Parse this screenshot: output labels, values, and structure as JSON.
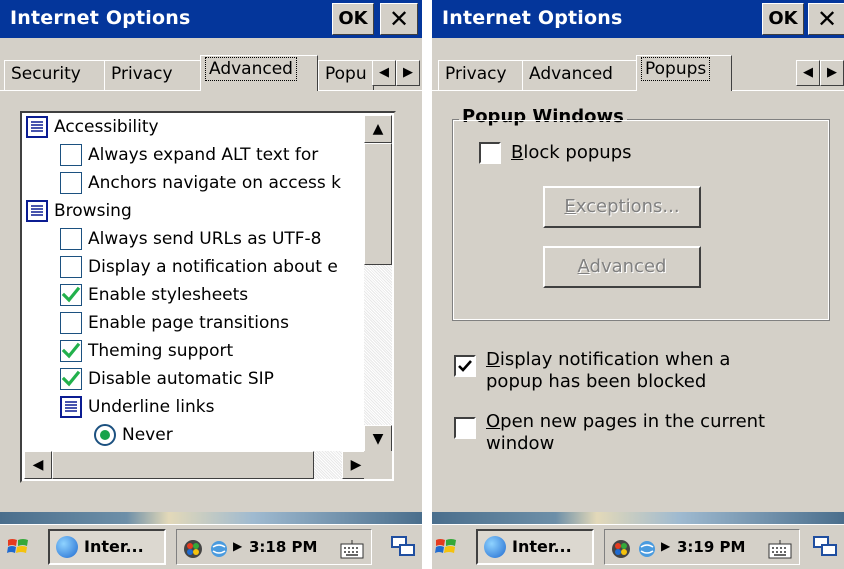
{
  "left": {
    "window": {
      "title": "Internet Options",
      "ok_label": "OK",
      "close_label": "✕"
    },
    "tabs": [
      "Security",
      "Privacy",
      "Advanced",
      "Popu"
    ],
    "active_tab": "Advanced",
    "tree": [
      {
        "kind": "category",
        "label": "Accessibility"
      },
      {
        "kind": "checkbox",
        "label": "Always expand ALT text for",
        "checked": false
      },
      {
        "kind": "checkbox",
        "label": "Anchors navigate on access k",
        "checked": false
      },
      {
        "kind": "category",
        "label": "Browsing"
      },
      {
        "kind": "checkbox",
        "label": "Always send URLs as UTF-8",
        "checked": false
      },
      {
        "kind": "checkbox",
        "label": "Display a notification about e",
        "checked": false
      },
      {
        "kind": "checkbox",
        "label": "Enable stylesheets",
        "checked": true
      },
      {
        "kind": "checkbox",
        "label": "Enable page transitions",
        "checked": false
      },
      {
        "kind": "checkbox",
        "label": "Theming support",
        "checked": true
      },
      {
        "kind": "checkbox",
        "label": "Disable automatic SIP",
        "checked": true
      },
      {
        "kind": "category",
        "label": "Underline links"
      },
      {
        "kind": "radio",
        "label": "Never",
        "selected": true
      }
    ],
    "taskbar": {
      "task_label": "Inter...",
      "clock": "3:18 PM"
    }
  },
  "right": {
    "window": {
      "title": "Internet Options",
      "ok_label": "OK",
      "close_label": "✕"
    },
    "tabs": [
      "Privacy",
      "Advanced",
      "Popups"
    ],
    "active_tab": "Popups",
    "group": {
      "title": "Popup Windows",
      "block_popups": {
        "label_mnemonic": "B",
        "label_rest": "lock popups",
        "checked": false
      },
      "exceptions_button": {
        "mnemonic": "E",
        "rest": "xceptions..."
      },
      "advanced_button": {
        "before": "",
        "mnemonic": "A",
        "rest": "dvanced"
      }
    },
    "options": [
      {
        "mnemonic": "D",
        "line1_rest": "isplay notification when a",
        "line2": "popup has been blocked",
        "checked": true
      },
      {
        "mnemonic": "O",
        "line1_rest": "pen new pages in the current",
        "line2": "window",
        "checked": false
      }
    ],
    "taskbar": {
      "task_label": "Inter...",
      "clock": "3:19 PM"
    }
  },
  "colors": {
    "titlebar": "#04369b",
    "dialog": "#d4d0c8",
    "check": "#22b14c"
  }
}
